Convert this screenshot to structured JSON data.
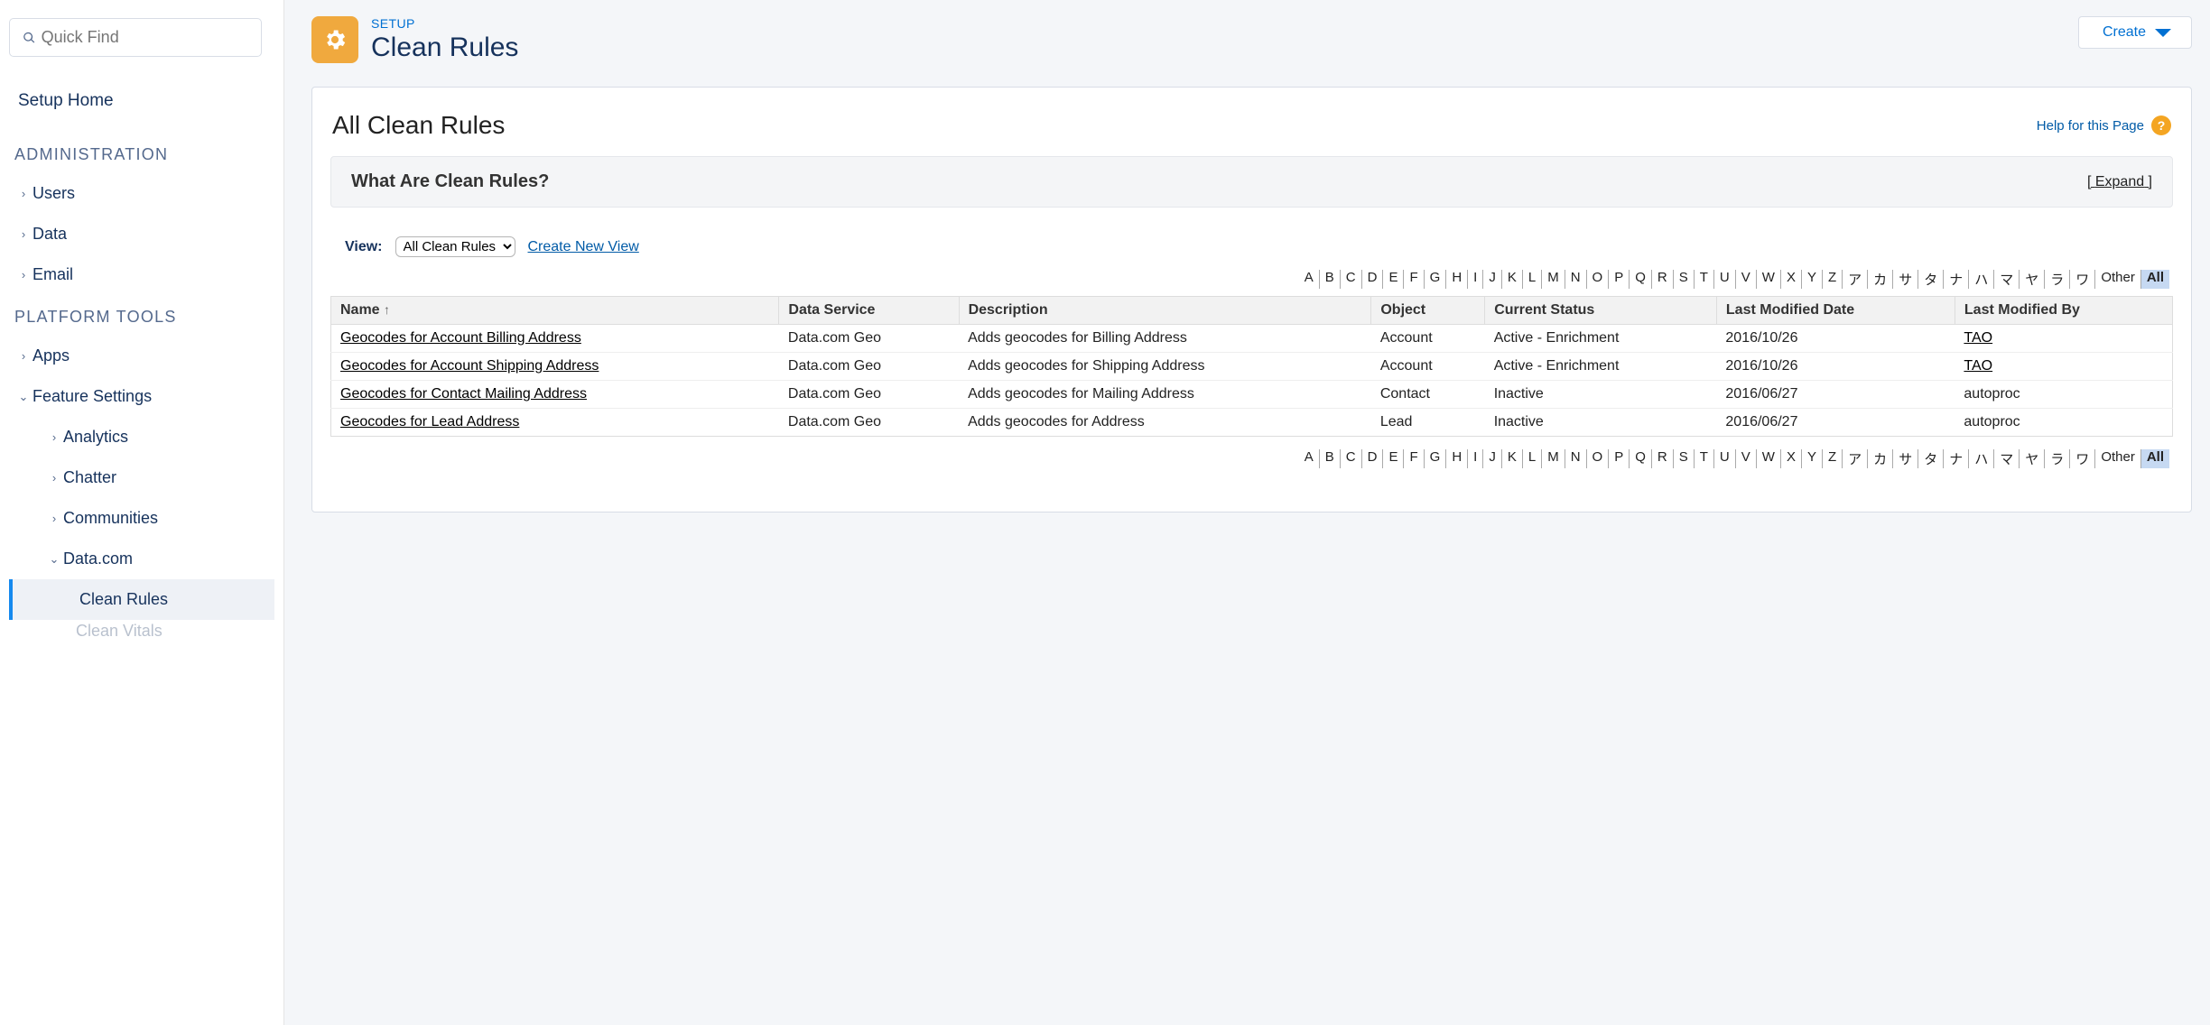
{
  "search": {
    "placeholder": "Quick Find"
  },
  "nav": {
    "setup_home": "Setup Home",
    "section_admin": "ADMINISTRATION",
    "admin": {
      "users": "Users",
      "data": "Data",
      "email": "Email"
    },
    "section_platform": "PLATFORM TOOLS",
    "platform": {
      "apps": "Apps",
      "feature_settings": "Feature Settings",
      "analytics": "Analytics",
      "chatter": "Chatter",
      "communities": "Communities",
      "data_com": "Data.com",
      "clean_rules": "Clean Rules",
      "clean_vitals": "Clean Vitals"
    }
  },
  "header": {
    "crumb": "SETUP",
    "title": "Clean Rules",
    "create": "Create"
  },
  "panel": {
    "title": "All Clean Rules",
    "help": "Help for this Page",
    "what_title": "What Are Clean Rules?",
    "expand_open": "[ ",
    "expand": "Expand",
    "expand_close": " ]",
    "view_label": "View:",
    "view_selected": "All Clean Rules",
    "create_view": "Create New View"
  },
  "alpha": [
    "A",
    "B",
    "C",
    "D",
    "E",
    "F",
    "G",
    "H",
    "I",
    "J",
    "K",
    "L",
    "M",
    "N",
    "O",
    "P",
    "Q",
    "R",
    "S",
    "T",
    "U",
    "V",
    "W",
    "X",
    "Y",
    "Z",
    "ア",
    "カ",
    "サ",
    "タ",
    "ナ",
    "ハ",
    "マ",
    "ヤ",
    "ラ",
    "ワ"
  ],
  "alpha_other": "Other",
  "alpha_all": "All",
  "table": {
    "headers": {
      "name": "Name",
      "data_service": "Data Service",
      "description": "Description",
      "object": "Object",
      "status": "Current Status",
      "mod_date": "Last Modified Date",
      "mod_by": "Last Modified By"
    },
    "rows": [
      {
        "name": "Geocodes for Account Billing Address",
        "service": "Data.com Geo",
        "desc": "Adds geocodes for Billing Address",
        "object": "Account",
        "status": "Active - Enrichment",
        "date": "2016/10/26",
        "by": "TAO",
        "by_link": true
      },
      {
        "name": "Geocodes for Account Shipping Address",
        "service": "Data.com Geo",
        "desc": "Adds geocodes for Shipping Address",
        "object": "Account",
        "status": "Active - Enrichment",
        "date": "2016/10/26",
        "by": "TAO",
        "by_link": true
      },
      {
        "name": "Geocodes for Contact Mailing Address",
        "service": "Data.com Geo",
        "desc": "Adds geocodes for Mailing Address",
        "object": "Contact",
        "status": "Inactive",
        "date": "2016/06/27",
        "by": "autoproc",
        "by_link": false
      },
      {
        "name": "Geocodes for Lead Address",
        "service": "Data.com Geo",
        "desc": "Adds geocodes for Address",
        "object": "Lead",
        "status": "Inactive",
        "date": "2016/06/27",
        "by": "autoproc",
        "by_link": false
      }
    ]
  }
}
